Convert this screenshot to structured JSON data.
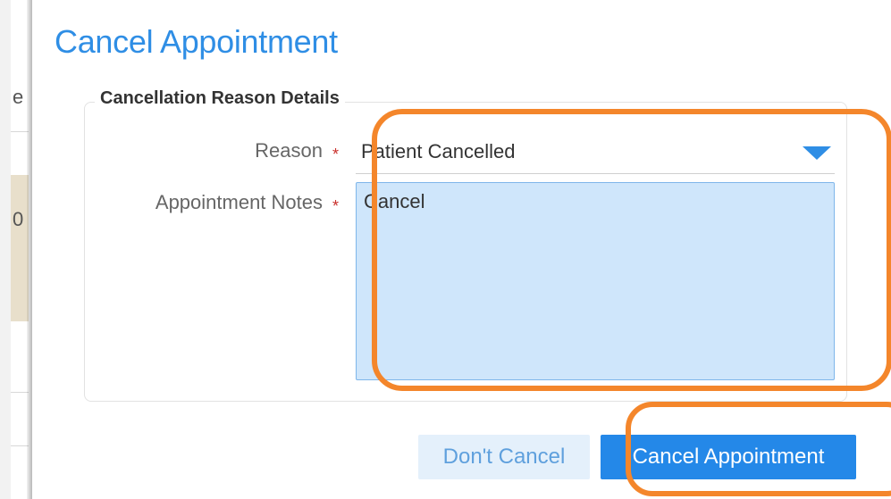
{
  "background": {
    "partial_chars": [
      "e",
      "0"
    ]
  },
  "modal": {
    "title": "Cancel Appointment",
    "fieldset_legend": "Cancellation Reason Details",
    "reason": {
      "label": "Reason",
      "required_marker": "*",
      "value": "Patient Cancelled"
    },
    "notes": {
      "label": "Appointment Notes",
      "required_marker": "*",
      "value": "Cancel"
    },
    "buttons": {
      "dont_cancel": "Don't Cancel",
      "cancel_appointment": "Cancel Appointment"
    }
  },
  "colors": {
    "accent": "#2f8ee5",
    "primary_button": "#2488e8",
    "secondary_button_bg": "#e4f0fb",
    "textarea_bg": "#cfe6fb",
    "required": "#c9302c",
    "annotation": "#f4862b"
  },
  "icons": {
    "select_caret": "caret-down-icon"
  }
}
